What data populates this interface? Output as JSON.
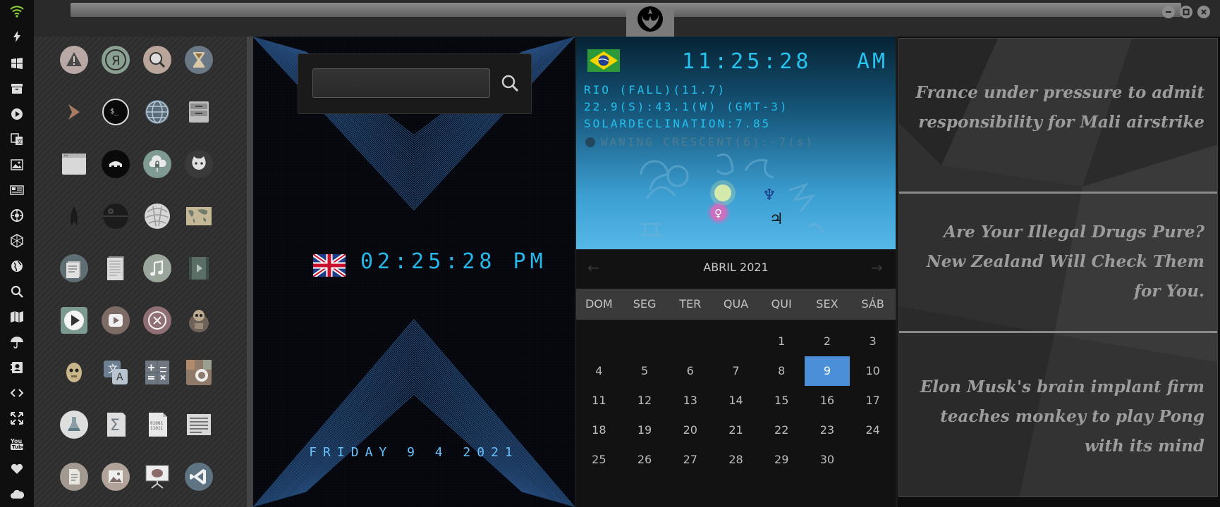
{
  "uk_clock": {
    "time": "02:25:28 PM",
    "date": "FRIDAY 9 4 2021"
  },
  "search": {
    "value": "",
    "placeholder": ""
  },
  "rio": {
    "time": "11:25:28",
    "ampm": "AM",
    "location": "RIO (FALL)(11.7)",
    "coords": "22.9(S):43.1(W) (GMT-3)",
    "declination": "SOLARDECLINATION:7.85",
    "moon": "WANING CRESCENT(6):-7(s)"
  },
  "calendar": {
    "month": "ABRIL 2021",
    "prev": "←",
    "next": "→",
    "weekdays": [
      "DOM",
      "SEG",
      "TER",
      "QUA",
      "QUI",
      "SEX",
      "SÁB"
    ],
    "days": [
      "1",
      "2",
      "3",
      "4",
      "5",
      "6",
      "7",
      "8",
      "9",
      "10",
      "11",
      "12",
      "13",
      "14",
      "15",
      "16",
      "17",
      "18",
      "19",
      "20",
      "21",
      "22",
      "23",
      "24",
      "25",
      "26",
      "27",
      "28",
      "29",
      "30"
    ],
    "today": "9"
  },
  "news": [
    "France under pressure to admit responsibility for Mali airstrike",
    "Are Your Illegal Drugs Pure? New Zealand Will Check Them for You.",
    "Elon Musk's brain implant firm teaches monkey to play Pong with its mind"
  ],
  "icons": {
    "dock": [
      "wifi-icon",
      "flash-icon",
      "windows-icon",
      "archive-icon",
      "play-icon",
      "translate-icon",
      "image-icon",
      "news-icon",
      "settings-icon",
      "hexagon-icon",
      "globe-icon",
      "search-icon",
      "map-icon",
      "umbrella-icon",
      "contact-icon",
      "code-icon",
      "expand-icon",
      "youtube-icon",
      "heart-icon",
      "cloud-icon"
    ],
    "apps": [
      "warning-icon",
      "yandex-icon",
      "search-icon",
      "hourglass-icon",
      "terminal-prompt-icon",
      "console-icon",
      "globe-icon",
      "file-server-icon",
      "window-icon",
      "sleep-mask-icon",
      "cloud-lock-icon",
      "github-icon",
      "starfleet-icon",
      "death-star-icon",
      "wikipedia-icon",
      "world-map-icon",
      "book-icon",
      "document-icon",
      "music-icon",
      "video-icon",
      "play-button-icon",
      "video-player-icon",
      "close-circle-icon",
      "robot-icon",
      "c3po-icon",
      "translate-icon",
      "calculator-icon",
      "camera-icon",
      "lab-flask-icon",
      "sum-icon",
      "binary-file-icon",
      "text-lines-icon",
      "text-file-icon",
      "image-viewer-icon",
      "presentation-icon",
      "vscode-icon"
    ]
  },
  "colors": {
    "digital_cyan": "#26c3ee",
    "today_highlight": "#4b8fd8",
    "wifi_green": "#8bd23a"
  }
}
